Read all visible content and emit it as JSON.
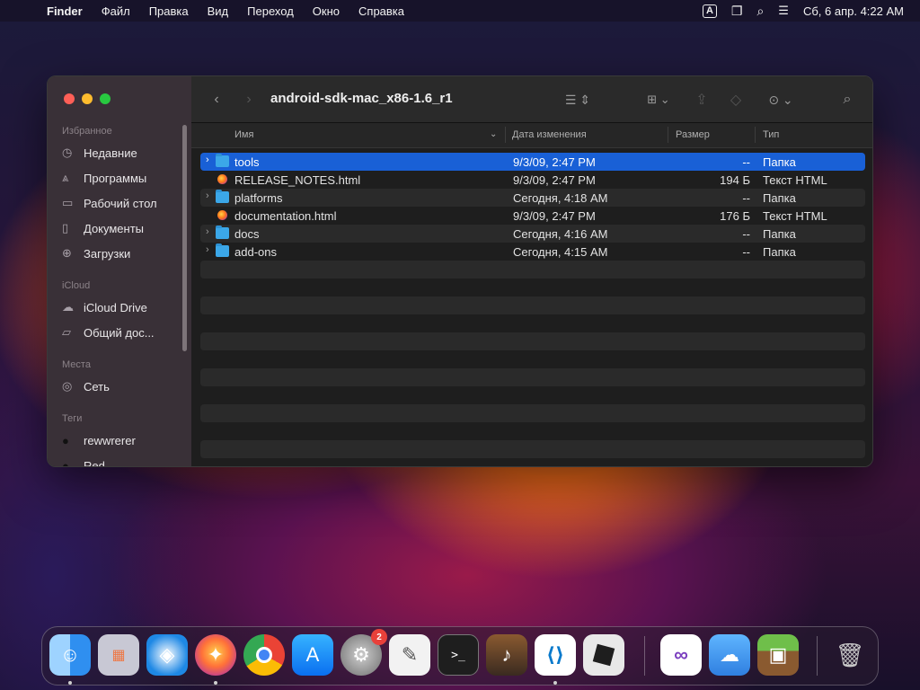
{
  "menubar": {
    "app_name": "Finder",
    "menus": [
      "Файл",
      "Правка",
      "Вид",
      "Переход",
      "Окно",
      "Справка"
    ],
    "input_source": "A",
    "clock": "Сб, 6 апр. 4:22 AM"
  },
  "window": {
    "title": "android-sdk-mac_x86-1.6_r1"
  },
  "sidebar": {
    "sections": [
      {
        "title": "Избранное",
        "items": [
          {
            "label": "Недавние",
            "icon": "clock-icon"
          },
          {
            "label": "Программы",
            "icon": "apps-icon"
          },
          {
            "label": "Рабочий стол",
            "icon": "desktop-icon"
          },
          {
            "label": "Документы",
            "icon": "document-icon"
          },
          {
            "label": "Загрузки",
            "icon": "download-icon"
          }
        ]
      },
      {
        "title": "iCloud",
        "items": [
          {
            "label": "iCloud Drive",
            "icon": "cloud-icon"
          },
          {
            "label": "Общий дос...",
            "icon": "shared-folder-icon"
          }
        ]
      },
      {
        "title": "Места",
        "items": [
          {
            "label": "Сеть",
            "icon": "network-icon"
          }
        ]
      },
      {
        "title": "Теги",
        "items": [
          {
            "label": "rewwrerer",
            "icon": "tag-dot-icon"
          },
          {
            "label": "Red",
            "icon": "tag-dot-icon"
          }
        ]
      }
    ]
  },
  "columns": {
    "name": "Имя",
    "date": "Дата изменения",
    "size": "Размер",
    "kind": "Тип"
  },
  "files": [
    {
      "name": "tools",
      "date": "9/3/09, 2:47 PM",
      "size": "--",
      "kind": "Папка",
      "type": "folder",
      "selected": true
    },
    {
      "name": "RELEASE_NOTES.html",
      "date": "9/3/09, 2:47 PM",
      "size": "194 Б",
      "kind": "Текст HTML",
      "type": "html"
    },
    {
      "name": "platforms",
      "date": "Сегодня, 4:18 AM",
      "size": "--",
      "kind": "Папка",
      "type": "folder"
    },
    {
      "name": "documentation.html",
      "date": "9/3/09, 2:47 PM",
      "size": "176 Б",
      "kind": "Текст HTML",
      "type": "html"
    },
    {
      "name": "docs",
      "date": "Сегодня, 4:16 AM",
      "size": "--",
      "kind": "Папка",
      "type": "folder"
    },
    {
      "name": "add-ons",
      "date": "Сегодня, 4:15 AM",
      "size": "--",
      "kind": "Папка",
      "type": "folder"
    }
  ],
  "dock": {
    "apps": [
      {
        "name": "Finder",
        "icon": "finder-icon",
        "color": "#2f8ff0",
        "running": true
      },
      {
        "name": "Launchpad",
        "icon": "launchpad-icon",
        "color": "#b8b8c8"
      },
      {
        "name": "Safari",
        "icon": "safari-icon",
        "color": "#1e88e5"
      },
      {
        "name": "Firefox",
        "icon": "firefox-icon",
        "color": "#ff7139",
        "running": true
      },
      {
        "name": "Chrome",
        "icon": "chrome-icon",
        "color": "#ffffff"
      },
      {
        "name": "App Store",
        "icon": "appstore-icon",
        "color": "#1a8cff"
      },
      {
        "name": "System Settings",
        "icon": "settings-icon",
        "color": "#8a8a8a",
        "badge": "2"
      },
      {
        "name": "TextEdit",
        "icon": "textedit-icon",
        "color": "#f2f2f2"
      },
      {
        "name": "Terminal",
        "icon": "terminal-icon",
        "color": "#1e1e1e"
      },
      {
        "name": "GarageBand",
        "icon": "garageband-icon",
        "color": "#3a2a20"
      },
      {
        "name": "VS Code",
        "icon": "vscode-icon",
        "color": "#ffffff",
        "running": true
      },
      {
        "name": "Roblox",
        "icon": "roblox-icon",
        "color": "#e8e8e8"
      },
      {
        "name": "Visual Studio",
        "icon": "visualstudio-icon",
        "color": "#ffffff"
      },
      {
        "name": "Weather",
        "icon": "weather-icon",
        "color": "#2f7fe0"
      },
      {
        "name": "Minecraft",
        "icon": "minecraft-icon",
        "color": "#5d9b3a"
      },
      {
        "name": "Trash",
        "icon": "trash-icon",
        "color": "#9a9a9a"
      }
    ]
  }
}
